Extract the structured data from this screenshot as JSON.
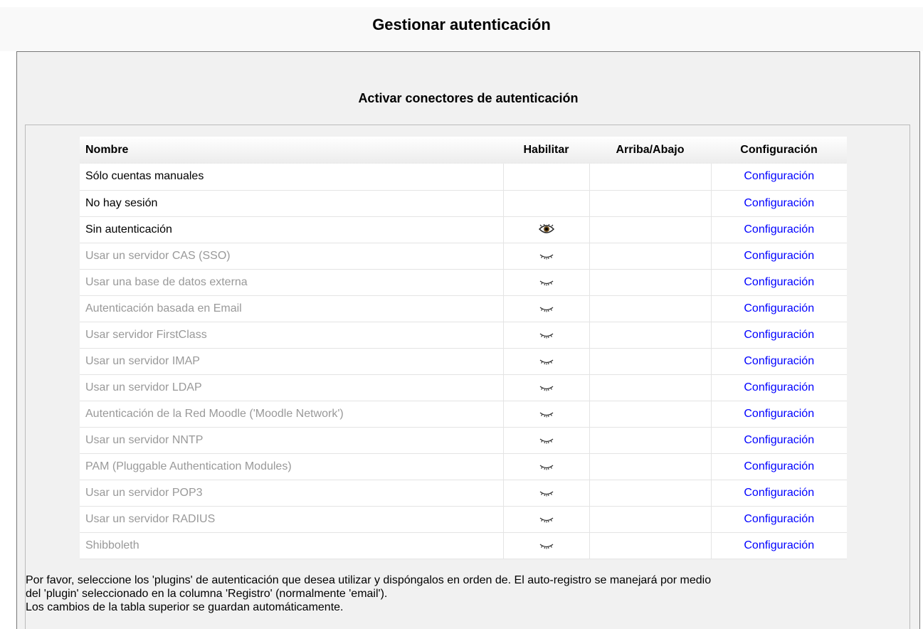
{
  "page_title": "Gestionar autenticación",
  "section_title": "Activar conectores de autenticación",
  "table": {
    "headers": {
      "name": "Nombre",
      "enable": "Habilitar",
      "updown": "Arriba/Abajo",
      "config": "Configuración"
    },
    "rows": [
      {
        "name": "Sólo cuentas manuales",
        "state": "locked",
        "config": "Configuración"
      },
      {
        "name": "No hay sesión",
        "state": "locked",
        "config": "Configuración"
      },
      {
        "name": "Sin autenticación",
        "state": "enabled",
        "config": "Configuración"
      },
      {
        "name": "Usar un servidor CAS (SSO)",
        "state": "disabled",
        "config": "Configuración"
      },
      {
        "name": "Usar una base de datos externa",
        "state": "disabled",
        "config": "Configuración"
      },
      {
        "name": "Autenticación basada en Email",
        "state": "disabled",
        "config": "Configuración"
      },
      {
        "name": "Usar servidor FirstClass",
        "state": "disabled",
        "config": "Configuración"
      },
      {
        "name": "Usar un servidor IMAP",
        "state": "disabled",
        "config": "Configuración"
      },
      {
        "name": "Usar un servidor LDAP",
        "state": "disabled",
        "config": "Configuración"
      },
      {
        "name": "Autenticación de la Red Moodle ('Moodle Network')",
        "state": "disabled",
        "config": "Configuración"
      },
      {
        "name": "Usar un servidor NNTP",
        "state": "disabled",
        "config": "Configuración"
      },
      {
        "name": "PAM (Pluggable Authentication Modules)",
        "state": "disabled",
        "config": "Configuración"
      },
      {
        "name": "Usar un servidor POP3",
        "state": "disabled",
        "config": "Configuración"
      },
      {
        "name": "Usar un servidor RADIUS",
        "state": "disabled",
        "config": "Configuración"
      },
      {
        "name": "Shibboleth",
        "state": "disabled",
        "config": "Configuración"
      }
    ]
  },
  "footer": {
    "line1": "Por favor, seleccione los 'plugins' de autenticación que desea utilizar y dispóngalos en orden de. El auto-registro se manejará por medio",
    "line2": "del 'plugin' seleccionado en la columna 'Registro' (normalmente 'email').",
    "line3": "Los cambios de la tabla superior se guardan automáticamente."
  },
  "colors": {
    "link": "#0000ff",
    "disabled_text": "#999999",
    "panel_bg": "#f1f1f1"
  },
  "icons": {
    "enabled": "eye-open-icon",
    "disabled": "eye-closed-icon"
  }
}
